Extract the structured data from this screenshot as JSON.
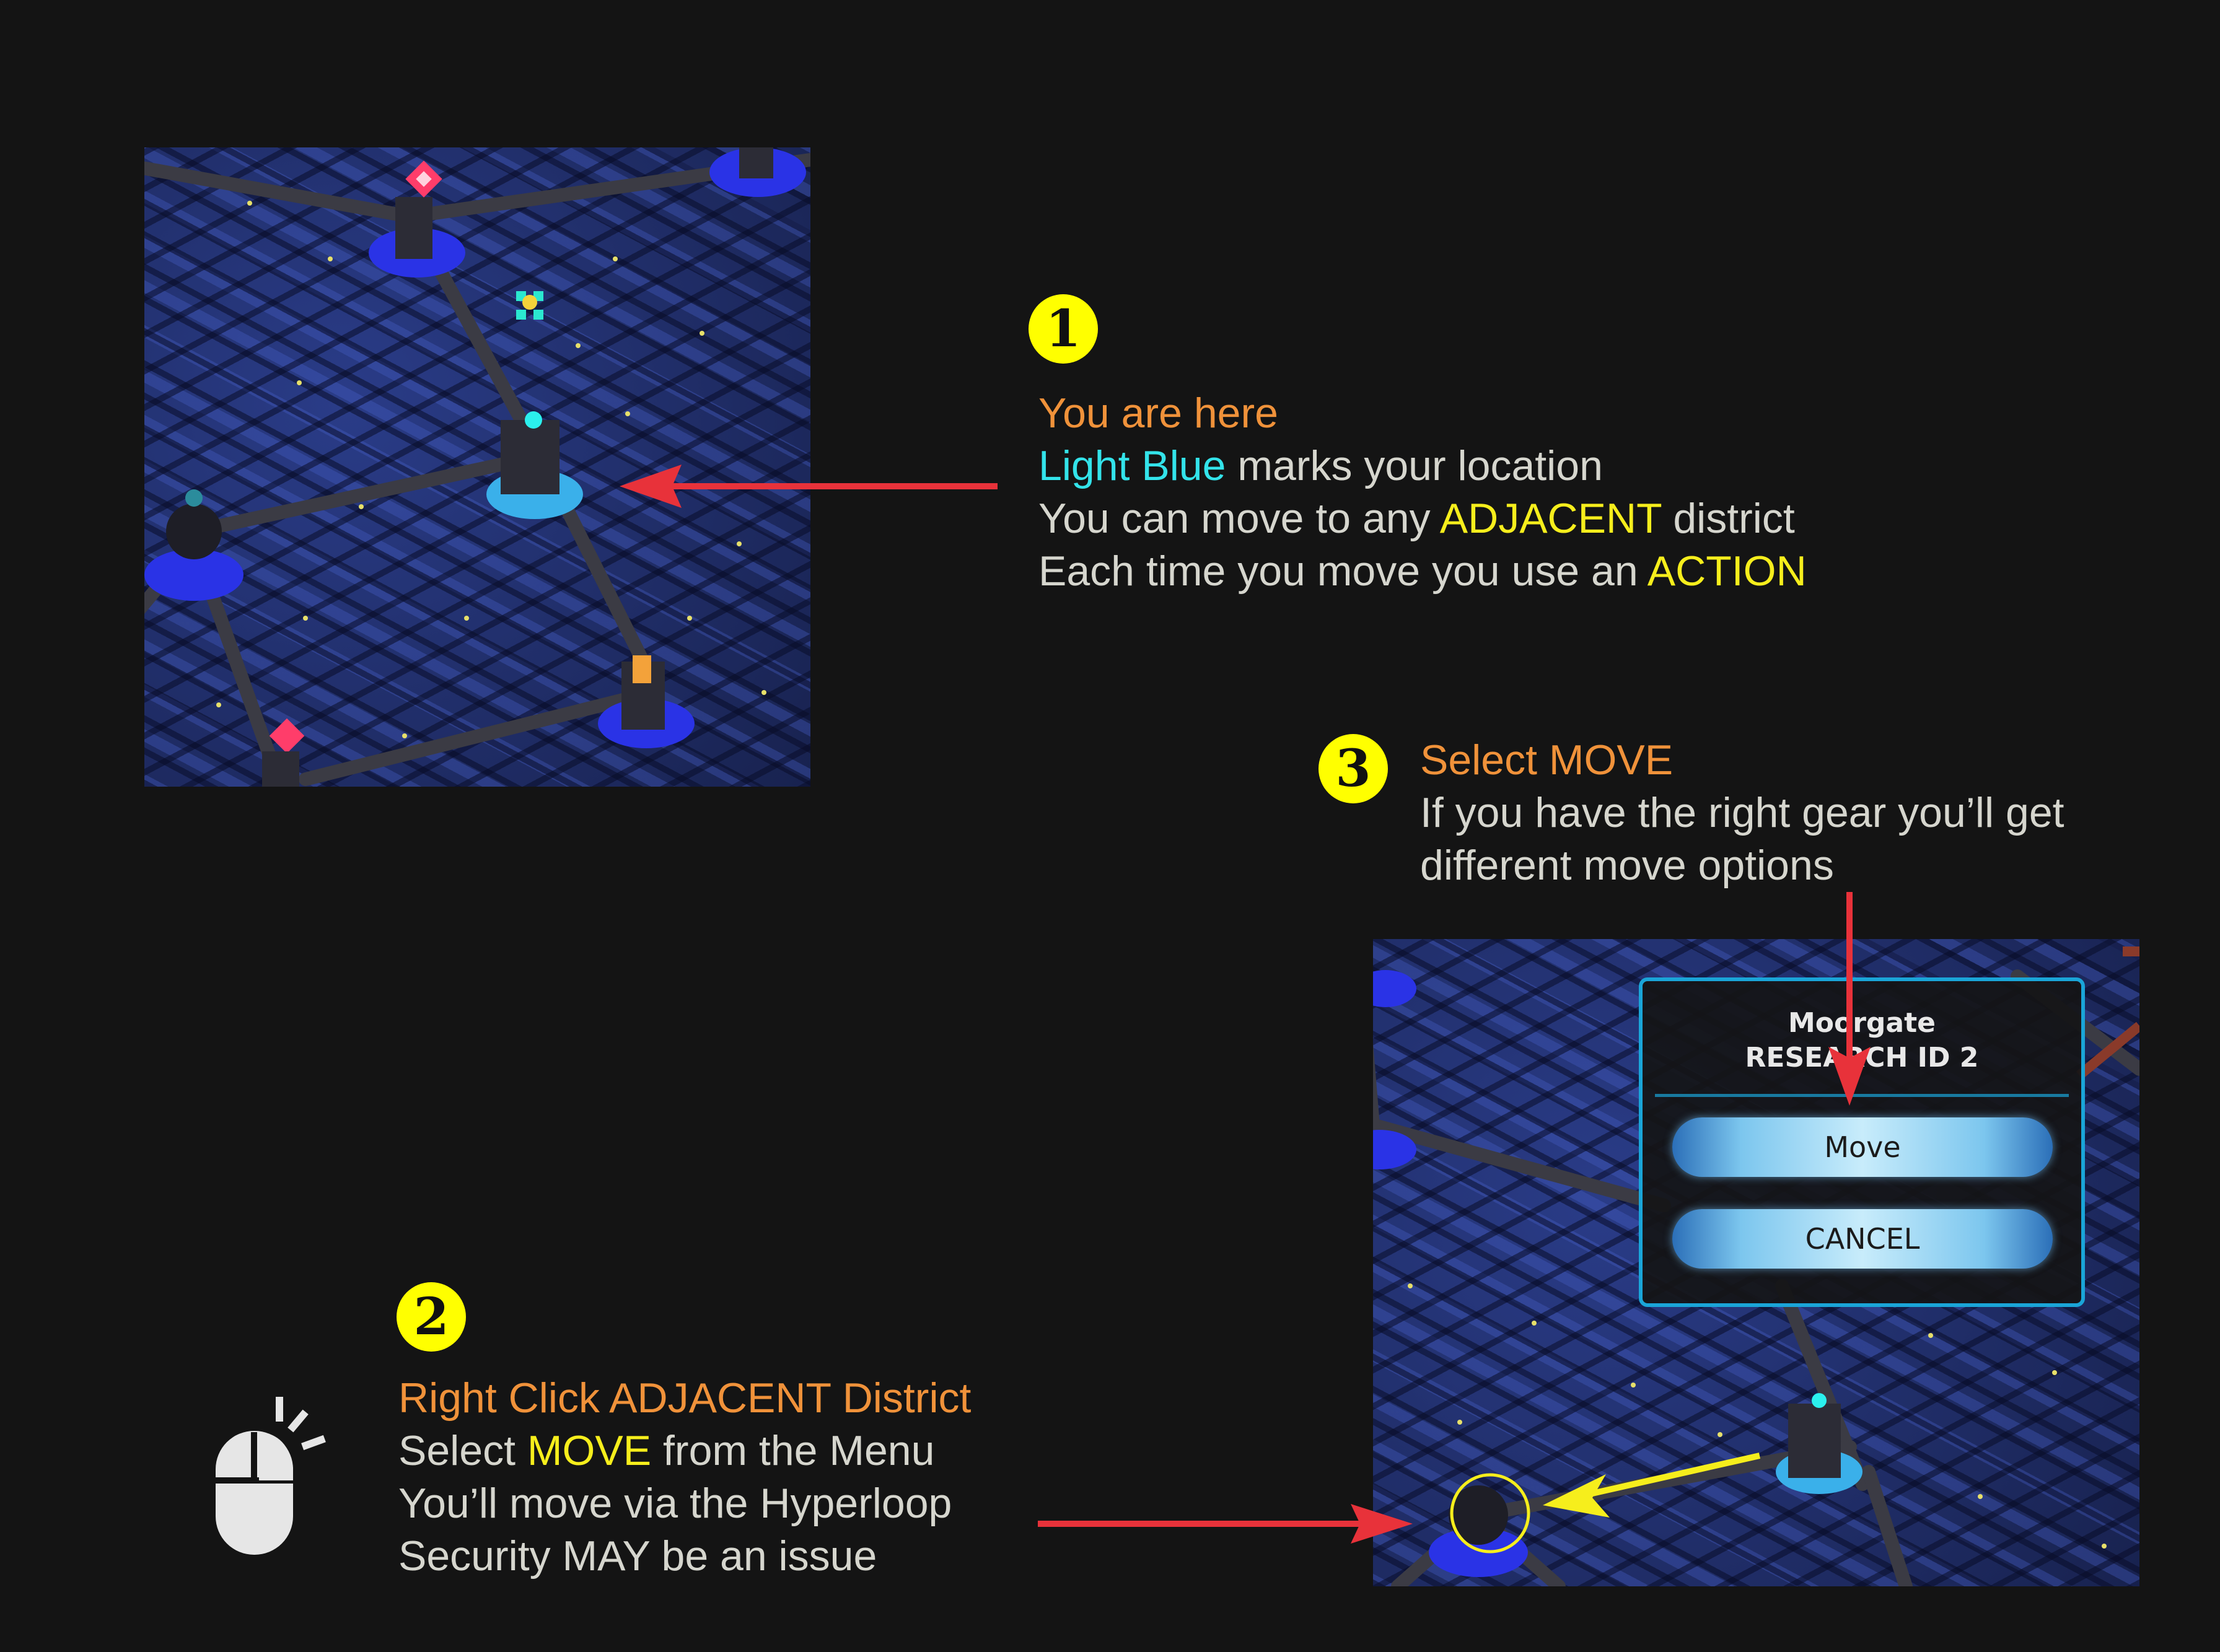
{
  "step1": {
    "number": "1",
    "title": "You are here",
    "line2_highlight": "Light Blue",
    "line2_rest": " marks your location",
    "line3_pre": "You can move to any ",
    "line3_highlight": "ADJACENT",
    "line3_post": " district",
    "line4_pre": "Each time you move you use an ",
    "line4_highlight": "ACTION"
  },
  "step2": {
    "number": "2",
    "title": "Right Click ADJACENT District",
    "line2_pre": "Select ",
    "line2_highlight": "MOVE",
    "line2_post": " from the Menu",
    "line3": "You’ll move via the Hyperloop",
    "line4": "Security MAY be an issue"
  },
  "step3": {
    "number": "3",
    "title": "Select MOVE",
    "line2": "If you have the right gear you’ll get",
    "line3": "different move options"
  },
  "menu": {
    "district_name": "Moorgate",
    "district_type": "RESEARCH ID 2",
    "move_button": "Move",
    "cancel_button": "CANCEL"
  },
  "icons": {
    "mouse": "mouse-right-click-icon",
    "map_node_current": "light-blue-node-icon",
    "map_node": "district-node-icon"
  },
  "colors": {
    "background": "#141414",
    "title": "#f0923a",
    "highlight": "#f6ee1c",
    "current_location": "#33e3ea",
    "arrow": "#e8323a",
    "menu_border": "#1aa5d8"
  }
}
